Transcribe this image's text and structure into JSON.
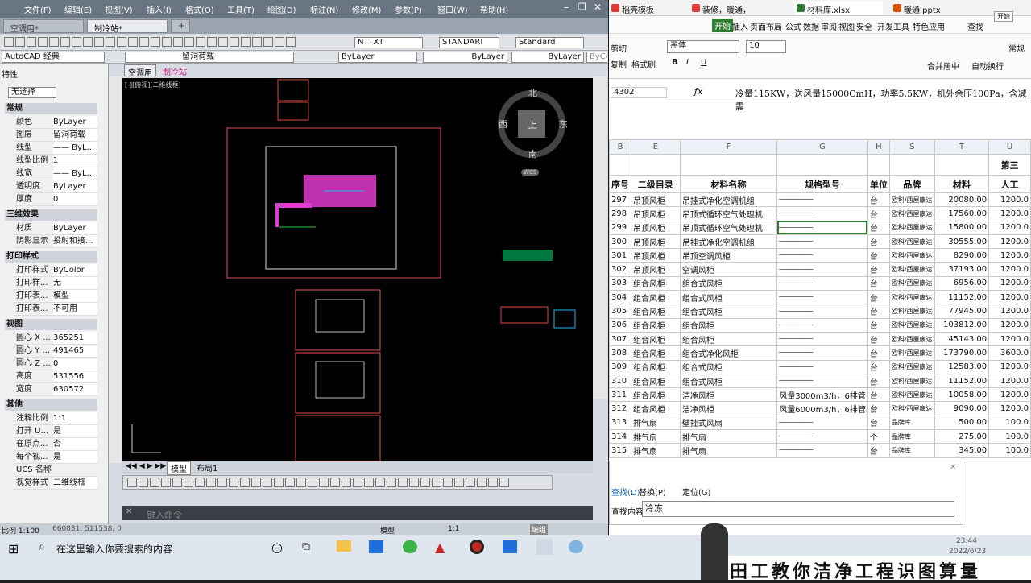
{
  "cad": {
    "menu": [
      "文件(F)",
      "编辑(E)",
      "视图(V)",
      "插入(I)",
      "格式(O)",
      "工具(T)",
      "绘图(D)",
      "标注(N)",
      "修改(M)",
      "参数(P)",
      "窗口(W)",
      "帮助(H)"
    ],
    "file_tabs": [
      "空调用*",
      "制冷站*"
    ],
    "toolbar": {
      "text_style": "NTTXT",
      "dim_style": "STANDARI",
      "table_style": "Standard"
    },
    "workspace": "AutoCAD 经典",
    "layer": "留洞荷载",
    "color_combo": "ByLayer",
    "linetype_combo": "ByLayer",
    "lineweight_combo": "ByLayer",
    "plot_style": "ByCo",
    "props": {
      "title": "特性",
      "selection": "无选择",
      "sections": [
        {
          "title": "常规",
          "rows": [
            [
              "颜色",
              "ByLayer"
            ],
            [
              "图层",
              "留洞荷载"
            ],
            [
              "线型",
              "—— ByL..."
            ],
            [
              "线型比例",
              "1"
            ],
            [
              "线宽",
              "—— ByL..."
            ],
            [
              "透明度",
              "ByLayer"
            ],
            [
              "厚度",
              "0"
            ]
          ]
        },
        {
          "title": "三维效果",
          "rows": [
            [
              "材质",
              "ByLayer"
            ],
            [
              "阴影显示",
              "投射和接..."
            ]
          ]
        },
        {
          "title": "打印样式",
          "rows": [
            [
              "打印样式",
              "ByColor"
            ],
            [
              "打印样...",
              "无"
            ],
            [
              "打印表...",
              "模型"
            ],
            [
              "打印表...",
              "不可用"
            ]
          ]
        },
        {
          "title": "视图",
          "rows": [
            [
              "圆心 X ...",
              "365251"
            ],
            [
              "圆心 Y ...",
              "491465"
            ],
            [
              "圆心 Z ...",
              "0"
            ],
            [
              "高度",
              "531556"
            ],
            [
              "宽度",
              "630572"
            ]
          ]
        },
        {
          "title": "其他",
          "rows": [
            [
              "注释比例",
              "1:1"
            ],
            [
              "打开 U...",
              "是"
            ],
            [
              "在原点...",
              "否"
            ],
            [
              "每个视...",
              "是"
            ],
            [
              "UCS 名称",
              ""
            ],
            [
              "视觉样式",
              "二维线框"
            ]
          ]
        }
      ]
    },
    "viewport_tabs": [
      "空调用",
      "制冷站"
    ],
    "viewport_label": "[-][俯视][二维线框]",
    "viewcube": {
      "n": "北",
      "s": "南",
      "w": "西",
      "e": "东",
      "top": "上",
      "wcs": "WCS"
    },
    "layout_tabs": [
      "模型",
      "布局1"
    ],
    "command_placeholder": "键入命令",
    "status_left": "比例 1:100",
    "coords": "660831, 511538, 0",
    "status_model": "模型",
    "status_scale": "1:1",
    "status_ws": "编组"
  },
  "sheet": {
    "tabs": [
      "稻壳模板",
      "装修，暖通，",
      "材料库.xlsx",
      "暖通.pptx"
    ],
    "tab_colors": [
      "#e53935",
      "#e53935",
      "#e53935",
      "#e65100"
    ],
    "menu": [
      "开始",
      "插入",
      "页面布局",
      "公式",
      "数据",
      "审阅",
      "视图",
      "安全",
      "开发工具",
      "特色应用",
      "查找"
    ],
    "ribbon": {
      "cut": "剪切",
      "copy": "复制",
      "format_painter": "格式刷",
      "font": "黑体",
      "size": "10",
      "merge": "合并居中",
      "wrap": "自动换行",
      "normal": "常规",
      "start_btn": "开始"
    },
    "cell_ref": "4302",
    "formula": "冷量115KW，送风量15000CmH，功率5.5KW，机外余压100Pa，含减震",
    "col_headers": [
      "B",
      "E",
      "F",
      "G",
      "H",
      "S",
      "T",
      "U"
    ],
    "header_row": [
      "序号",
      "二级目录",
      "材料名称",
      "规格型号",
      "单位",
      "品牌",
      "材料",
      "人工"
    ],
    "section_label": "第三",
    "rows": [
      [
        "297",
        "吊顶风柜",
        "吊挂式净化空调机组",
        "sm",
        "台",
        "欧科/西屋康达",
        "20080.00",
        "1200.0"
      ],
      [
        "298",
        "吊顶风柜",
        "吊顶式循环空气处理机",
        "sm",
        "台",
        "欧科/西屋康达",
        "17560.00",
        "1200.0"
      ],
      [
        "299",
        "吊顶风柜",
        "吊顶式循环空气处理机",
        "sm",
        "台",
        "欧科/西屋康达",
        "15800.00",
        "1200.0"
      ],
      [
        "300",
        "吊顶风柜",
        "吊挂式净化空调机组",
        "sm",
        "台",
        "欧科/西屋康达",
        "30555.00",
        "1200.0"
      ],
      [
        "301",
        "吊顶风柜",
        "吊顶空调风柜",
        "sm",
        "台",
        "欧科/西屋康达",
        "8290.00",
        "1200.0"
      ],
      [
        "302",
        "吊顶风柜",
        "空调风柜",
        "sm",
        "台",
        "欧科/西屋康达",
        "37193.00",
        "1200.0"
      ],
      [
        "303",
        "组合风柜",
        "组合式风柜",
        "sm",
        "台",
        "欧科/西屋康达",
        "6956.00",
        "1200.0"
      ],
      [
        "304",
        "组合风柜",
        "组合式风柜",
        "sm",
        "台",
        "欧科/西屋康达",
        "11152.00",
        "1200.0"
      ],
      [
        "305",
        "组合风柜",
        "组合式风柜",
        "sm",
        "台",
        "欧科/西屋康达",
        "77945.00",
        "1200.0"
      ],
      [
        "306",
        "组合风柜",
        "组合风柜",
        "sm",
        "台",
        "欧科/西屋康达",
        "103812.00",
        "1200.0"
      ],
      [
        "307",
        "组合风柜",
        "组合风柜",
        "sm",
        "台",
        "欧科/西屋康达",
        "45143.00",
        "1200.0"
      ],
      [
        "308",
        "组合风柜",
        "组合式净化风柜",
        "sm",
        "台",
        "欧科/西屋康达",
        "173790.00",
        "3600.0"
      ],
      [
        "309",
        "组合风柜",
        "组合式风柜",
        "sm",
        "台",
        "欧科/西屋康达",
        "12583.00",
        "1200.0"
      ],
      [
        "310",
        "组合风柜",
        "组合式风柜",
        "sm",
        "台",
        "欧科/西屋康达",
        "11152.00",
        "1200.0"
      ],
      [
        "311",
        "组合风柜",
        "洁净风柜",
        "风量3000m3/h，6排管",
        "台",
        "欧科/西屋康达",
        "10058.00",
        "1200.0"
      ],
      [
        "312",
        "组合风柜",
        "洁净风柜",
        "风量6000m3/h，6排管",
        "台",
        "欧科/西屋康达",
        "9090.00",
        "1200.0"
      ],
      [
        "313",
        "排气扇",
        "壁挂式风扇",
        "sm",
        "台",
        "品牌库",
        "500.00",
        "100.0"
      ],
      [
        "314",
        "排气扇",
        "排气扇",
        "sm",
        "个",
        "品牌库",
        "275.00",
        "100.0"
      ],
      [
        "315",
        "排气扇",
        "排气扇",
        "sm",
        "台",
        "品牌库",
        "345.00",
        "100.0"
      ]
    ],
    "find": {
      "tabs": [
        "查找(D)",
        "替换(P)",
        "定位(G)"
      ],
      "label": "查找内容(N):",
      "value": "冷冻"
    }
  },
  "taskbar": {
    "search_placeholder": "在这里输入你要搜索的内容",
    "time": "23:44",
    "date": "2022/6/23",
    "banner": "田工教你洁净工程识图算量"
  }
}
